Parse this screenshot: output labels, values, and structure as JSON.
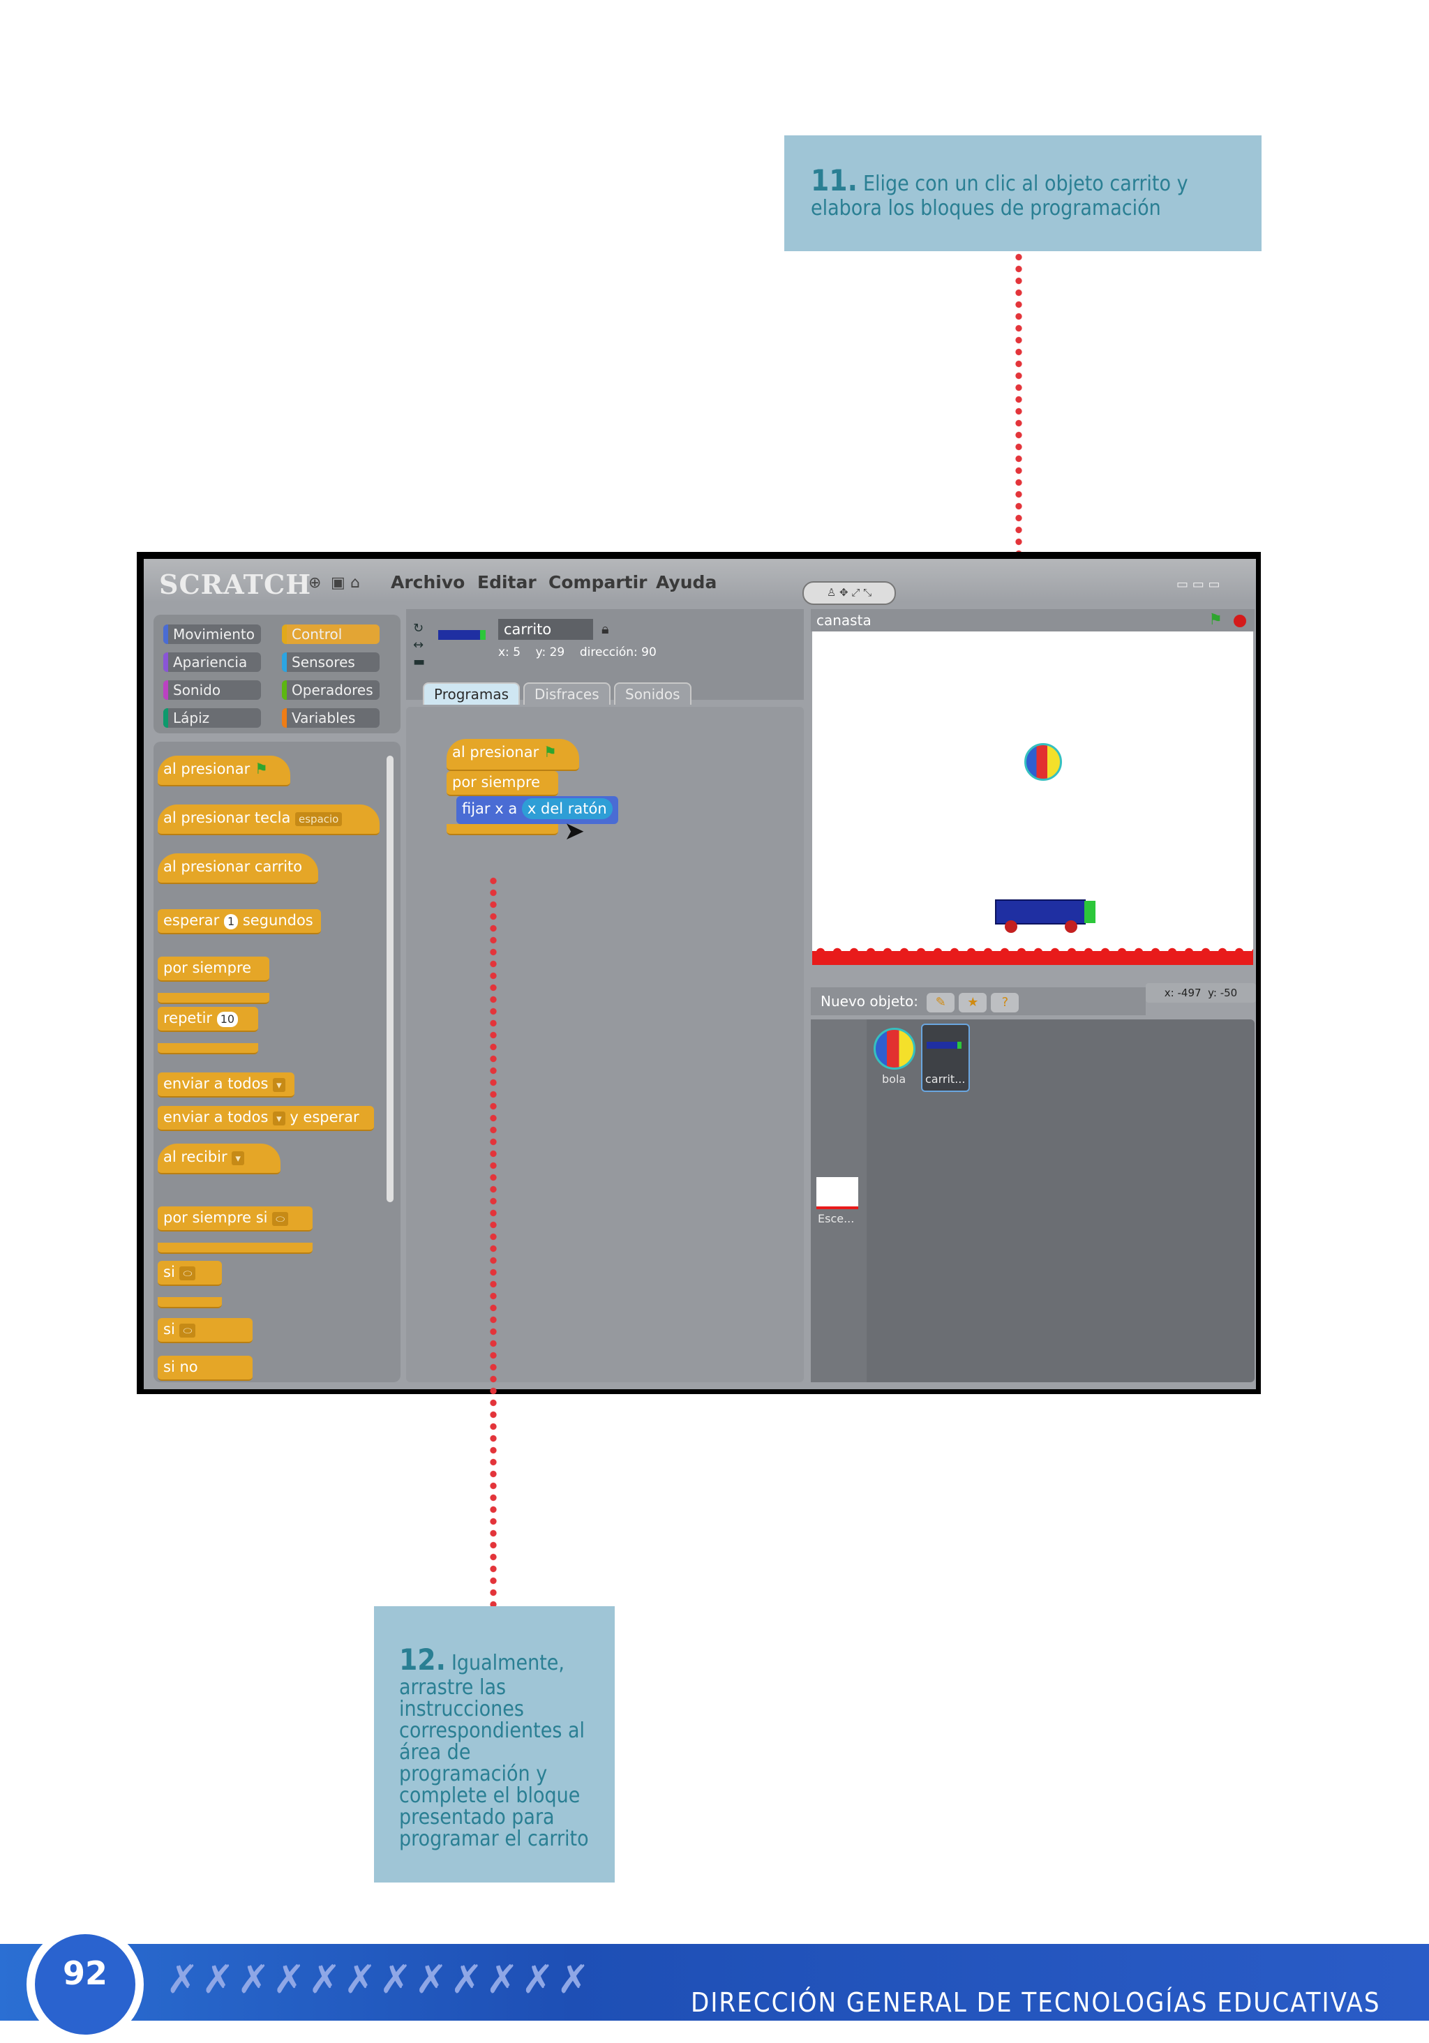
{
  "callout11": {
    "number": "11.",
    "text": "Elige con un clic al objeto carrito y elabora los bloques de programación"
  },
  "callout12": {
    "number": "12.",
    "text": "Igualmente, arrastre las instrucciones correspondientes al área de programación y complete el bloque presentado para programar el carrito"
  },
  "scratch": {
    "logo": "SCRATCH",
    "menu": [
      "Archivo",
      "Editar",
      "Compartir",
      "Ayuda"
    ],
    "categories": [
      "Movimiento",
      "Control",
      "Apariencia",
      "Sensores",
      "Sonido",
      "Operadores",
      "Lápiz",
      "Variables"
    ],
    "category_colors": [
      "#4a6cd4",
      "#e1a91a",
      "#8a55d7",
      "#2ca5e2",
      "#bb42c3",
      "#5cb712",
      "#0e9a6c",
      "#ee7d16"
    ],
    "palette": {
      "when_flag": "al presionar",
      "when_key": "al presionar tecla",
      "key_value": "espacio",
      "when_clicked": "al presionar carrito",
      "wait": "esperar",
      "wait_value": "1",
      "wait_unit": "segundos",
      "forever": "por siempre",
      "repeat": "repetir",
      "repeat_value": "10",
      "broadcast": "enviar a todos",
      "broadcast_wait": "enviar a todos",
      "and_wait": "y esperar",
      "when_receive": "al recibir",
      "forever_if": "por siempre si",
      "if1": "si",
      "if2": "si",
      "else": "si no"
    },
    "sprite": {
      "name": "carrito",
      "x": "x: 5",
      "y": "y: 29",
      "direction": "dirección: 90"
    },
    "tabs": [
      "Programas",
      "Disfraces",
      "Sonidos"
    ],
    "script": {
      "hat": "al presionar",
      "forever": "por siempre",
      "set_x": "fijar x a",
      "mouse_x": "x del ratón"
    },
    "stage_title": "canasta",
    "mouse_coords": {
      "x": "x: -497",
      "y": "y: -50"
    },
    "new_object": "Nuevo objeto:",
    "sprites": [
      {
        "label": "bola"
      },
      {
        "label": "carrit..."
      }
    ],
    "stage_thumb": "Esce..."
  },
  "footer": {
    "page": "92",
    "title": "DIRECCIÓN GENERAL DE TECNOLOGÍAS EDUCATIVAS",
    "figures": "✗✗✗✗✗✗✗✗✗✗✗✗"
  }
}
